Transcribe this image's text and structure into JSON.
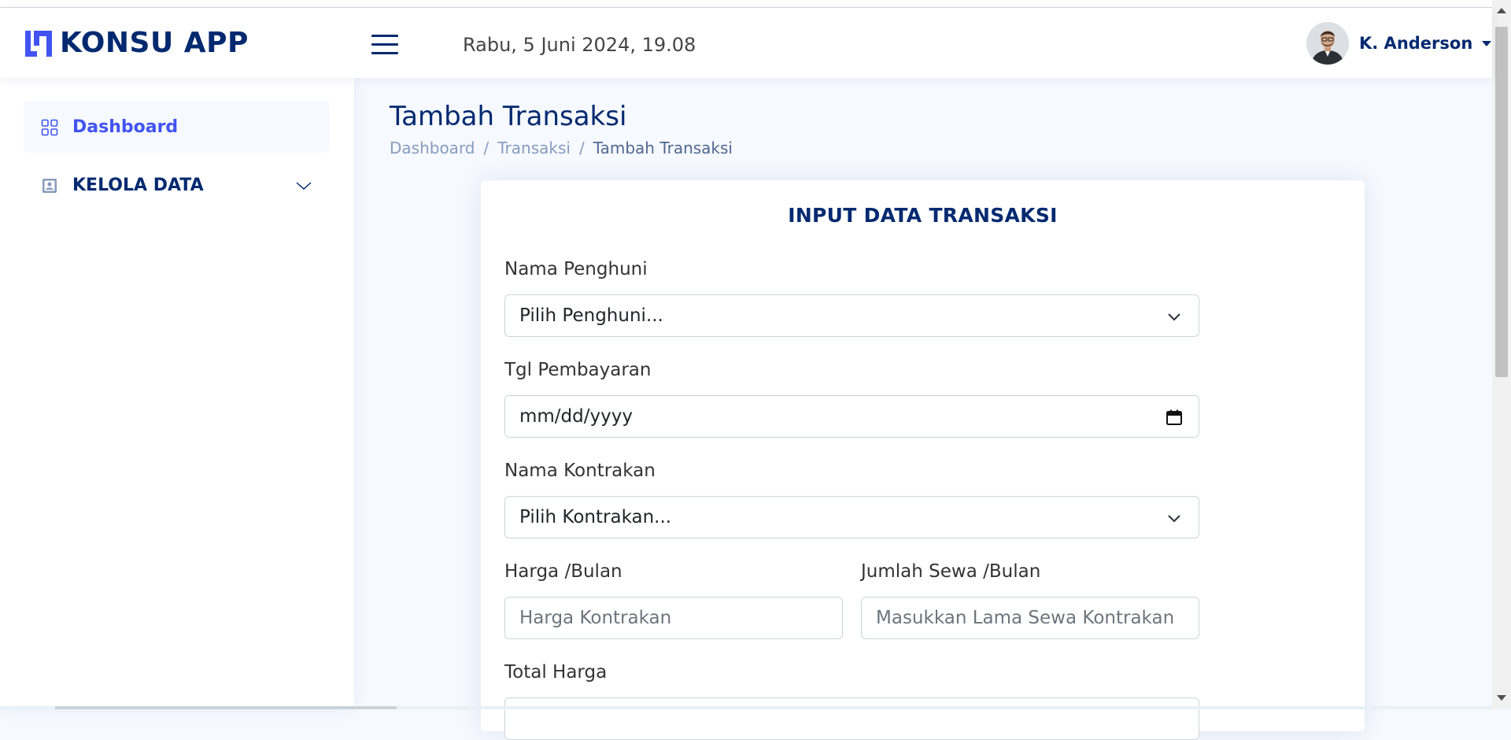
{
  "app": {
    "name": "KONSU APP"
  },
  "header": {
    "datetime": "Rabu, 5 Juni 2024, 19.08"
  },
  "profile": {
    "name": "K. Anderson"
  },
  "sidebar": {
    "items": [
      {
        "label": "Dashboard",
        "icon": "grid-icon",
        "active": true
      },
      {
        "label": "KELOLA DATA",
        "icon": "person-card-icon",
        "expandable": true
      }
    ]
  },
  "page": {
    "title": "Tambah Transaksi",
    "breadcrumb": [
      "Dashboard",
      "Transaksi",
      "Tambah Transaksi"
    ]
  },
  "form": {
    "title": "INPUT DATA TRANSAKSI",
    "fields": {
      "penghuni": {
        "label": "Nama Penghuni",
        "value": "Pilih Penghuni..."
      },
      "tgl": {
        "label": "Tgl Pembayaran",
        "value": "mm/dd/yyyy"
      },
      "kontrakan": {
        "label": "Nama Kontrakan",
        "value": "Pilih Kontrakan..."
      },
      "harga": {
        "label": "Harga /Bulan",
        "placeholder": "Harga Kontrakan"
      },
      "lama": {
        "label": "Jumlah Sewa /Bulan",
        "placeholder": "Masukkan Lama Sewa Kontrakan"
      },
      "total": {
        "label": "Total Harga"
      }
    }
  },
  "colors": {
    "primary": "#012970",
    "accent": "#4154f1",
    "background": "#f6f9ff",
    "muted": "#899bbd"
  }
}
